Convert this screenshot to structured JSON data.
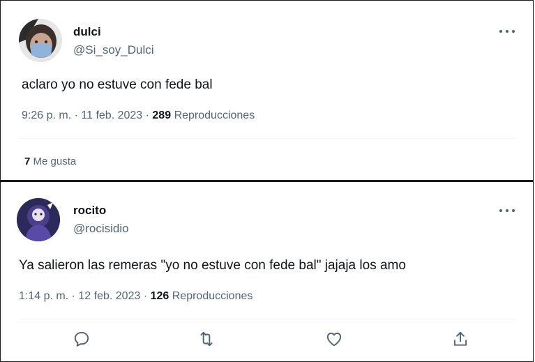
{
  "tweets": [
    {
      "name": "dulci",
      "handle": "@Si_soy_Dulci",
      "text": "aclaro yo no estuve con fede bal",
      "time": "9:26 p. m.",
      "sep": "·",
      "date": "11 feb. 2023",
      "views": "289",
      "views_label": "Reproducciones",
      "likes_count": "7",
      "likes_label": "Me gusta"
    },
    {
      "name": "rocito",
      "handle": "@rocisidio",
      "text": "Ya salieron las remeras \"yo no estuve con fede bal\" jajaja los amo",
      "time": "1:14 p. m.",
      "sep": "·",
      "date": "12 feb. 2023",
      "views": "126",
      "views_label": "Reproducciones"
    }
  ],
  "icons": {
    "more": "more-icon",
    "reply": "reply-icon",
    "retweet": "retweet-icon",
    "like": "heart-icon",
    "share": "share-icon"
  },
  "colors": {
    "text": "#0f1419",
    "secondary": "#536471",
    "divider": "#eff3f4"
  }
}
